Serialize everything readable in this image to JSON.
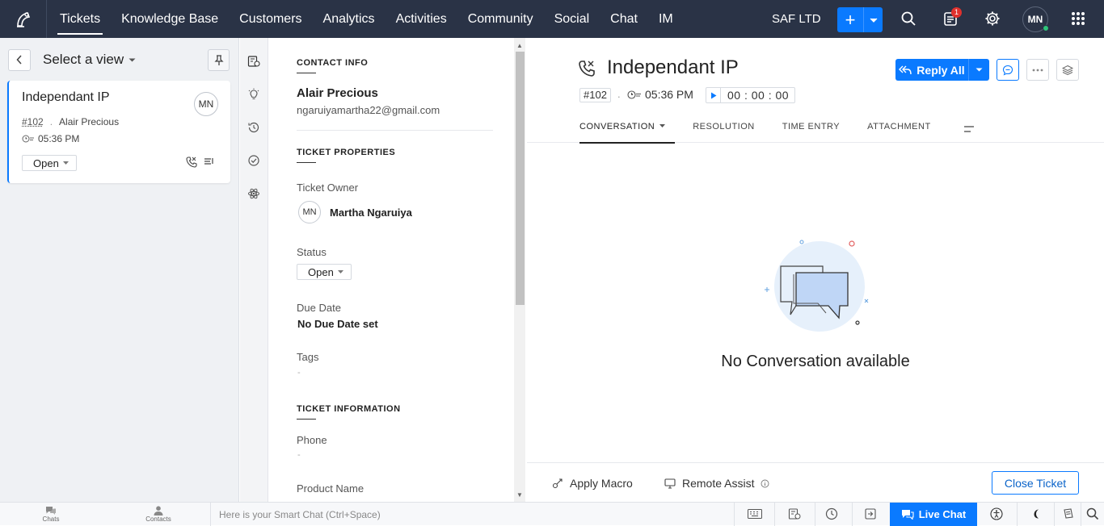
{
  "topbar": {
    "nav": [
      "Tickets",
      "Knowledge Base",
      "Customers",
      "Analytics",
      "Activities",
      "Community",
      "Social",
      "Chat",
      "IM"
    ],
    "org": "SAF LTD",
    "notification_count": "1",
    "avatar": "MN"
  },
  "left_panel": {
    "view_title": "Select a view",
    "card": {
      "title": "Independant IP",
      "avatar": "MN",
      "number": "#102",
      "contact": "Alair Precious",
      "time": "05:36 PM",
      "status": "Open"
    }
  },
  "props": {
    "contact_info_head": "CONTACT INFO",
    "contact_name": "Alair Precious",
    "contact_email": "ngaruiyamartha22@gmail.com",
    "ticket_properties_head": "TICKET PROPERTIES",
    "owner_label": "Ticket Owner",
    "owner_avatar": "MN",
    "owner_name": "Martha Ngaruiya",
    "status_label": "Status",
    "status_value": "Open",
    "due_label": "Due Date",
    "due_value": "No Due Date set",
    "tags_label": "Tags",
    "tags_value": "-",
    "ticket_info_head": "TICKET INFORMATION",
    "phone_label": "Phone",
    "phone_value": "-",
    "product_label": "Product Name"
  },
  "ticket": {
    "title": "Independant IP",
    "number": "#102",
    "dot": ".",
    "time": "05:36 PM",
    "timer": "00 : 00 : 00",
    "reply_label": "Reply All",
    "tabs": [
      "CONVERSATION",
      "RESOLUTION",
      "TIME ENTRY",
      "ATTACHMENT"
    ],
    "empty_message": "No Conversation available",
    "apply_macro": "Apply Macro",
    "remote_assist": "Remote Assist",
    "close_ticket": "Close Ticket"
  },
  "bottombar": {
    "chats": "Chats",
    "contacts": "Contacts",
    "smart_chat_placeholder": "Here is your Smart Chat (Ctrl+Space)",
    "live_chat": "Live Chat"
  },
  "colors": {
    "topbar_bg": "#2a3346",
    "accent": "#0a7aff",
    "badge": "#e0312d",
    "online": "#2ec57a"
  }
}
